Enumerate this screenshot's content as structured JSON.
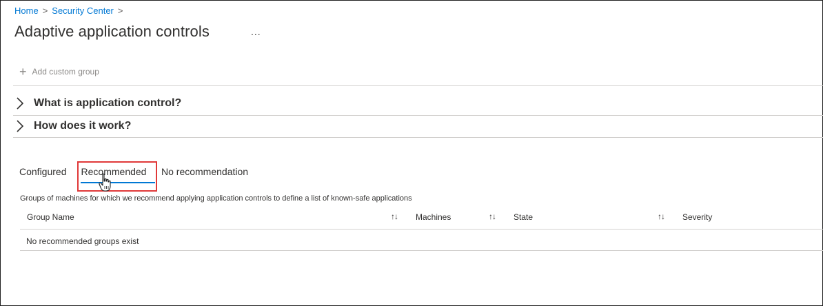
{
  "breadcrumb": {
    "home": "Home",
    "security_center": "Security Center",
    "separator": ">"
  },
  "page": {
    "title": "Adaptive application controls",
    "more": "..."
  },
  "toolbar": {
    "add_custom_group": "Add custom group",
    "add_icon": "+"
  },
  "expanders": [
    {
      "label": "What is application control?"
    },
    {
      "label": "How does it work?"
    }
  ],
  "tabs": {
    "configured": "Configured",
    "recommended": "Recommended",
    "no_recommendation": "No recommendation",
    "selected": "Recommended"
  },
  "description": "Groups of machines for which we recommend applying application controls to define a list of known-safe applications",
  "table": {
    "columns": [
      "Group Name",
      "Machines",
      "State",
      "Severity"
    ],
    "sort_glyph": "↑↓",
    "empty_message": "No recommended groups exist"
  },
  "colors": {
    "link": "#0078d4",
    "highlight": "#e03838",
    "selected_tab_underline": "#0078d4"
  }
}
